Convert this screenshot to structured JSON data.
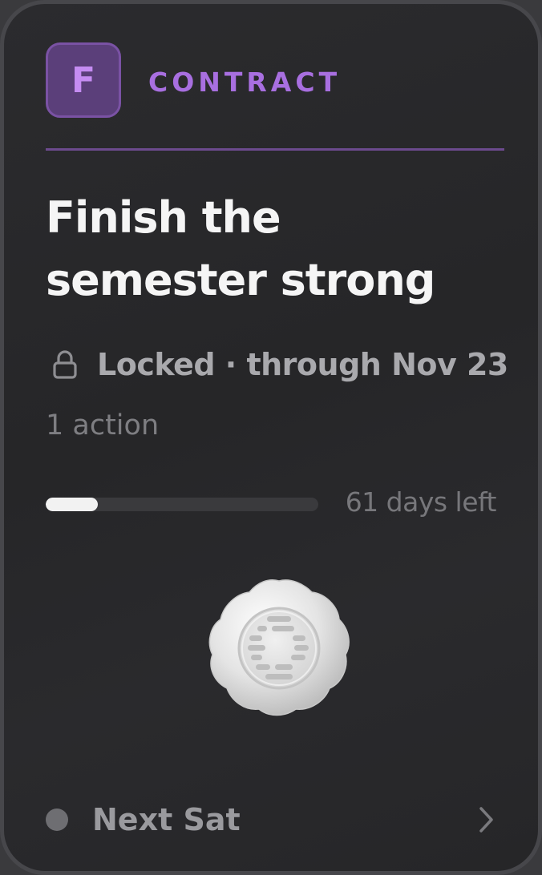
{
  "contract": {
    "badge_letter": "F",
    "type_label": "CONTRACT",
    "title": "Finish the semester strong",
    "status_text": "Locked · through Nov 23",
    "action_count_text": "1 action",
    "days_left_text": "61 days left",
    "progress_fraction": 0.19,
    "next_text": "Next Sat"
  },
  "icons": {
    "lock": "lock-icon",
    "seal": "wax-seal-icon",
    "status_dot": "status-dot-icon",
    "chevron": "chevron-right-icon"
  },
  "colors": {
    "accent": "#a86fe0",
    "badge_bg": "#5b3f7a",
    "card_bg": "#262628",
    "title": "#f5f5f5",
    "progress_fill": "#f2f2f2",
    "seal": "#e6e6e6"
  }
}
